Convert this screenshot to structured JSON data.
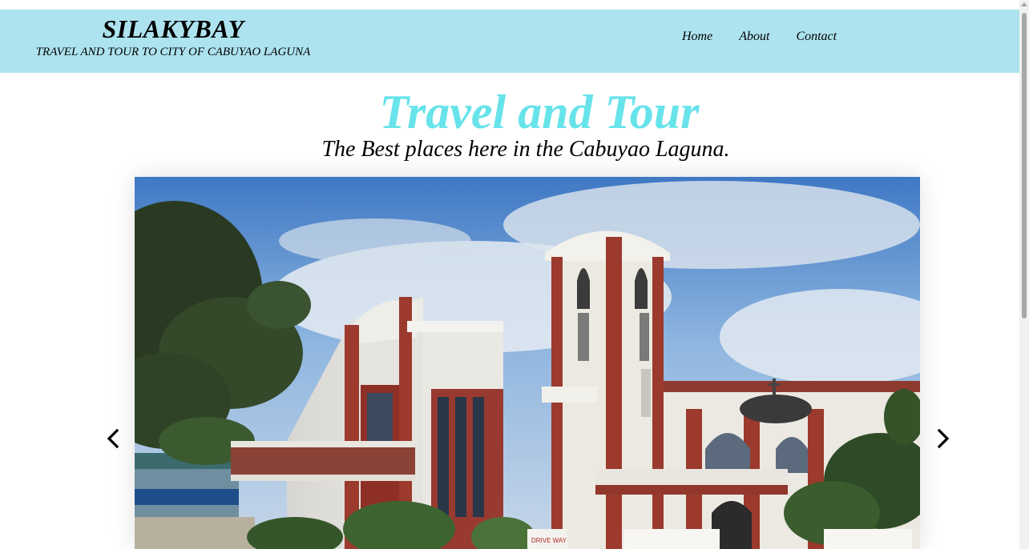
{
  "header": {
    "brand_name": "SILAKYBAY",
    "tagline": "TRAVEL AND TOUR TO CITY OF CABUYAO LAGUNA",
    "background": "#ade3ef"
  },
  "nav": {
    "home": "Home",
    "about": "About",
    "contact": "Contact"
  },
  "hero": {
    "title": "Travel and Tour",
    "subtitle": "The Best places here in the Cabuyao Laguna.",
    "title_color": "#67e3ea"
  },
  "slider": {
    "prev_icon": "chevron-left-icon",
    "next_icon": "chevron-right-icon",
    "sign_text": "DRIVE WAY"
  }
}
